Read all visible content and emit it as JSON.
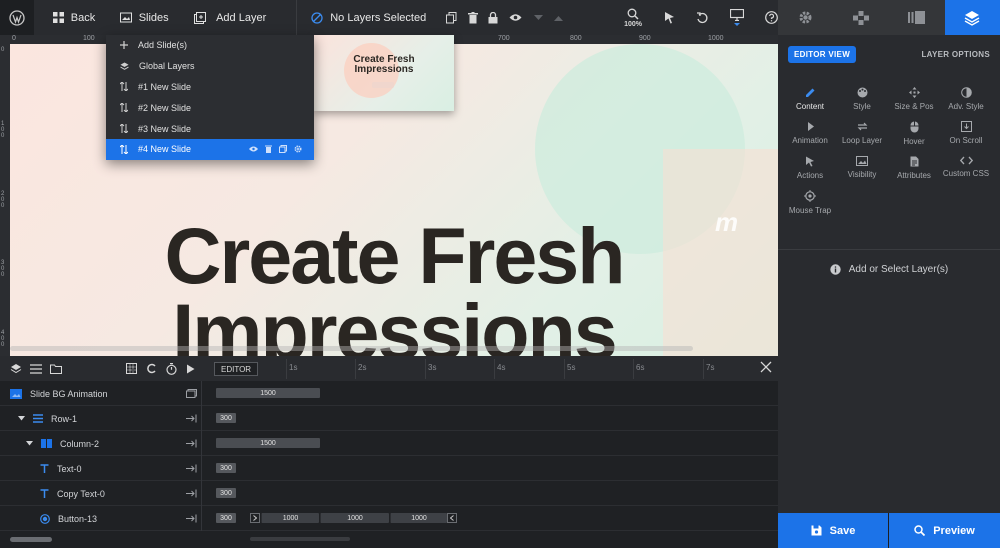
{
  "topbar": {
    "back_label": "Back",
    "slides_label": "Slides",
    "add_layer_label": "Add Layer",
    "no_layers_label": "No Layers Selected",
    "zoom_label": "100%"
  },
  "slides_menu": {
    "items": [
      {
        "label": "Add Slide(s)",
        "icon": "plus-icon"
      },
      {
        "label": "Global Layers",
        "icon": "layers-icon"
      },
      {
        "label": "#1 New Slide",
        "icon": "sort-icon"
      },
      {
        "label": "#2 New Slide",
        "icon": "sort-icon"
      },
      {
        "label": "#3 New Slide",
        "icon": "sort-icon"
      },
      {
        "label": "#4 New Slide",
        "icon": "sort-icon",
        "active": true
      }
    ]
  },
  "thumbnail": {
    "title_line1": "Create Fresh",
    "title_line2": "Impressions"
  },
  "ruler": {
    "top_ticks": [
      "0",
      "100",
      "700",
      "800",
      "900",
      "1000"
    ],
    "left_ticks": [
      "0",
      "100",
      "200",
      "300",
      "400"
    ]
  },
  "canvas": {
    "headline_line1": "Create Fresh",
    "headline_line2": "Impressions",
    "watermark": "m"
  },
  "right_panel": {
    "editor_view_label": "EDITOR VIEW",
    "layer_options_label": "LAYER OPTIONS",
    "items": [
      {
        "label": "Content",
        "icon": "pencil-icon"
      },
      {
        "label": "Style",
        "icon": "palette-icon"
      },
      {
        "label": "Size & Pos",
        "icon": "move-icon"
      },
      {
        "label": "Adv. Style",
        "icon": "contrast-icon"
      },
      {
        "label": "Animation",
        "icon": "play-icon"
      },
      {
        "label": "Loop Layer",
        "icon": "loop-icon"
      },
      {
        "label": "Hover",
        "icon": "mouse-icon"
      },
      {
        "label": "On Scroll",
        "icon": "scroll-icon"
      },
      {
        "label": "Actions",
        "icon": "cursor-icon"
      },
      {
        "label": "Visibility",
        "icon": "image-icon"
      },
      {
        "label": "Attributes",
        "icon": "document-icon"
      },
      {
        "label": "Custom CSS",
        "icon": "code-icon"
      },
      {
        "label": "Mouse Trap",
        "icon": "target-icon"
      }
    ],
    "empty_message": "Add or Select Layer(s)"
  },
  "buttons": {
    "save_label": "Save",
    "preview_label": "Preview"
  },
  "timeline": {
    "editor_tab_label": "EDITOR",
    "seconds": [
      "1s",
      "2s",
      "3s",
      "4s",
      "5s",
      "6s",
      "7s"
    ],
    "rows": [
      {
        "label": "Slide BG Animation",
        "bars": [
          "1500"
        ]
      },
      {
        "label": "Row-1",
        "bars": [
          "300"
        ]
      },
      {
        "label": "Column-2",
        "bars": [
          "1500"
        ]
      },
      {
        "label": "Text-0",
        "bars": [
          "300"
        ]
      },
      {
        "label": "Copy Text-0",
        "bars": [
          "300"
        ]
      },
      {
        "label": "Button-13",
        "bars": [
          "300",
          "1000",
          "1000",
          "1000"
        ]
      }
    ]
  }
}
